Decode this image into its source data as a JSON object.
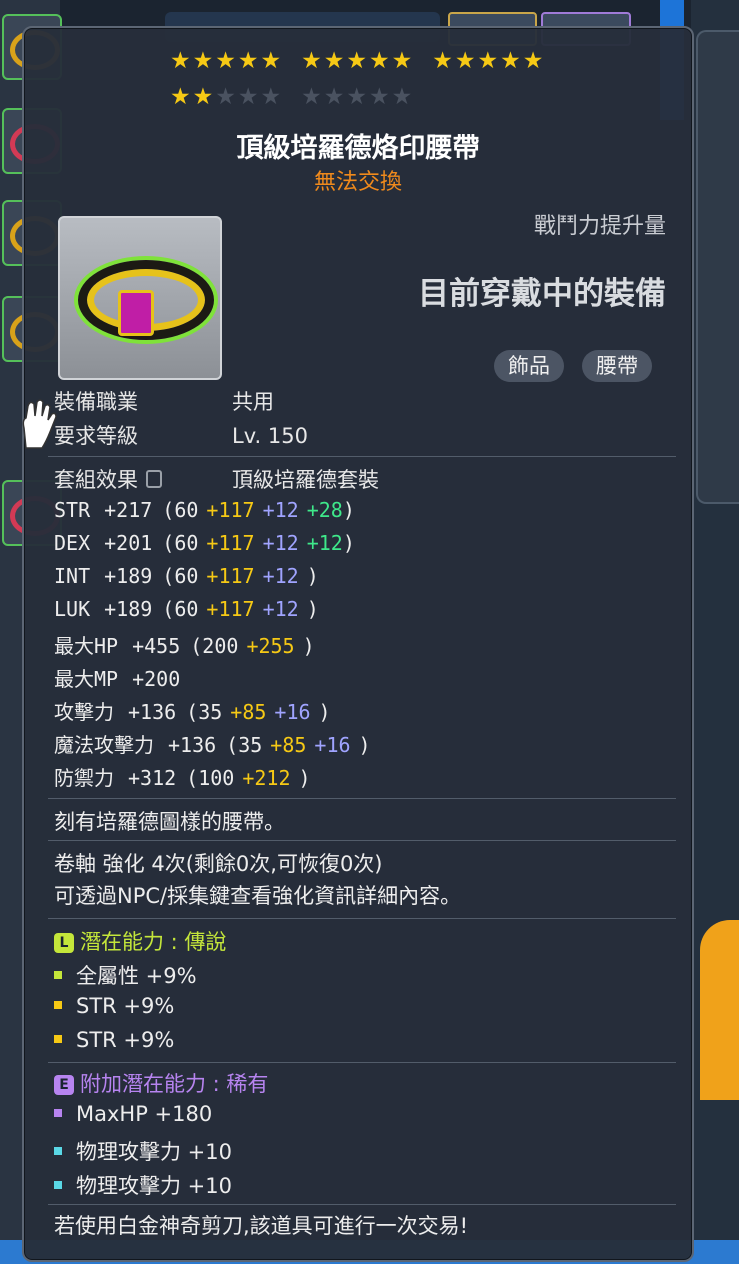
{
  "item": {
    "stars_filled": 17,
    "stars_total": 25,
    "name": "頂級培羅德烙印腰帶",
    "trade_status": "無法交換",
    "combat_power_label": "戰鬥力提升量",
    "currently_equipped": "目前穿戴中的裝備",
    "tags": [
      "飾品",
      "腰帶"
    ],
    "job_label": "裝備職業",
    "job_value": "共用",
    "level_label": "要求等級",
    "level_value": "Lv. 150",
    "set_label": "套組效果",
    "set_value": "頂級培羅德套裝",
    "stats": [
      {
        "name": "STR",
        "total": "+217",
        "open": "(60",
        "a": "+117",
        "b": "+12",
        "c": "+28",
        "close": ")"
      },
      {
        "name": "DEX",
        "total": "+201",
        "open": "(60",
        "a": "+117",
        "b": "+12",
        "c": "+12",
        "close": ")"
      },
      {
        "name": "INT",
        "total": "+189",
        "open": "(60",
        "a": "+117",
        "b": "+12",
        "c": "",
        "close": ")"
      },
      {
        "name": "LUK",
        "total": "+189",
        "open": "(60",
        "a": "+117",
        "b": "+12",
        "c": "",
        "close": ")"
      },
      {
        "name": "最大HP",
        "total": "+455",
        "open": "(200",
        "a": "+255",
        "b": "",
        "c": "",
        "close": ")"
      },
      {
        "name": "最大MP",
        "total": "+200",
        "open": "",
        "a": "",
        "b": "",
        "c": "",
        "close": ""
      },
      {
        "name": "攻擊力",
        "total": "+136",
        "open": "(35",
        "a": "+85",
        "b": "+16",
        "c": "",
        "close": ")"
      },
      {
        "name": "魔法攻擊力",
        "total": "+136",
        "open": "(35",
        "a": "+85",
        "b": "+16",
        "c": "",
        "close": ")"
      },
      {
        "name": "防禦力",
        "total": "+312",
        "open": "(100",
        "a": "+212",
        "b": "",
        "c": "",
        "close": ")"
      }
    ],
    "description": "刻有培羅德圖樣的腰帶。",
    "scroll_line": "卷軸 強化 4次(剩餘0次,可恢復0次)",
    "scroll_hint": "可透過NPC/採集鍵查看強化資訊詳細內容。",
    "potential": {
      "badge": "L",
      "title": "潛在能力 : 傳說",
      "lines": [
        "全屬性 +9%",
        "STR +9%",
        "STR +9%"
      ]
    },
    "additional_potential": {
      "badge": "E",
      "title": "附加潛在能力 : 稀有",
      "lines": [
        "MaxHP +180",
        "物理攻擊力 +10",
        "物理攻擊力 +10"
      ]
    },
    "footer": "若使用白金神奇剪刀,該道具可進行一次交易!"
  },
  "colors": {
    "star_on": "#f6c915",
    "untradeable": "#f08a1c",
    "potential_legendary": "#c4e63a",
    "potential_rare": "#b784f0"
  }
}
